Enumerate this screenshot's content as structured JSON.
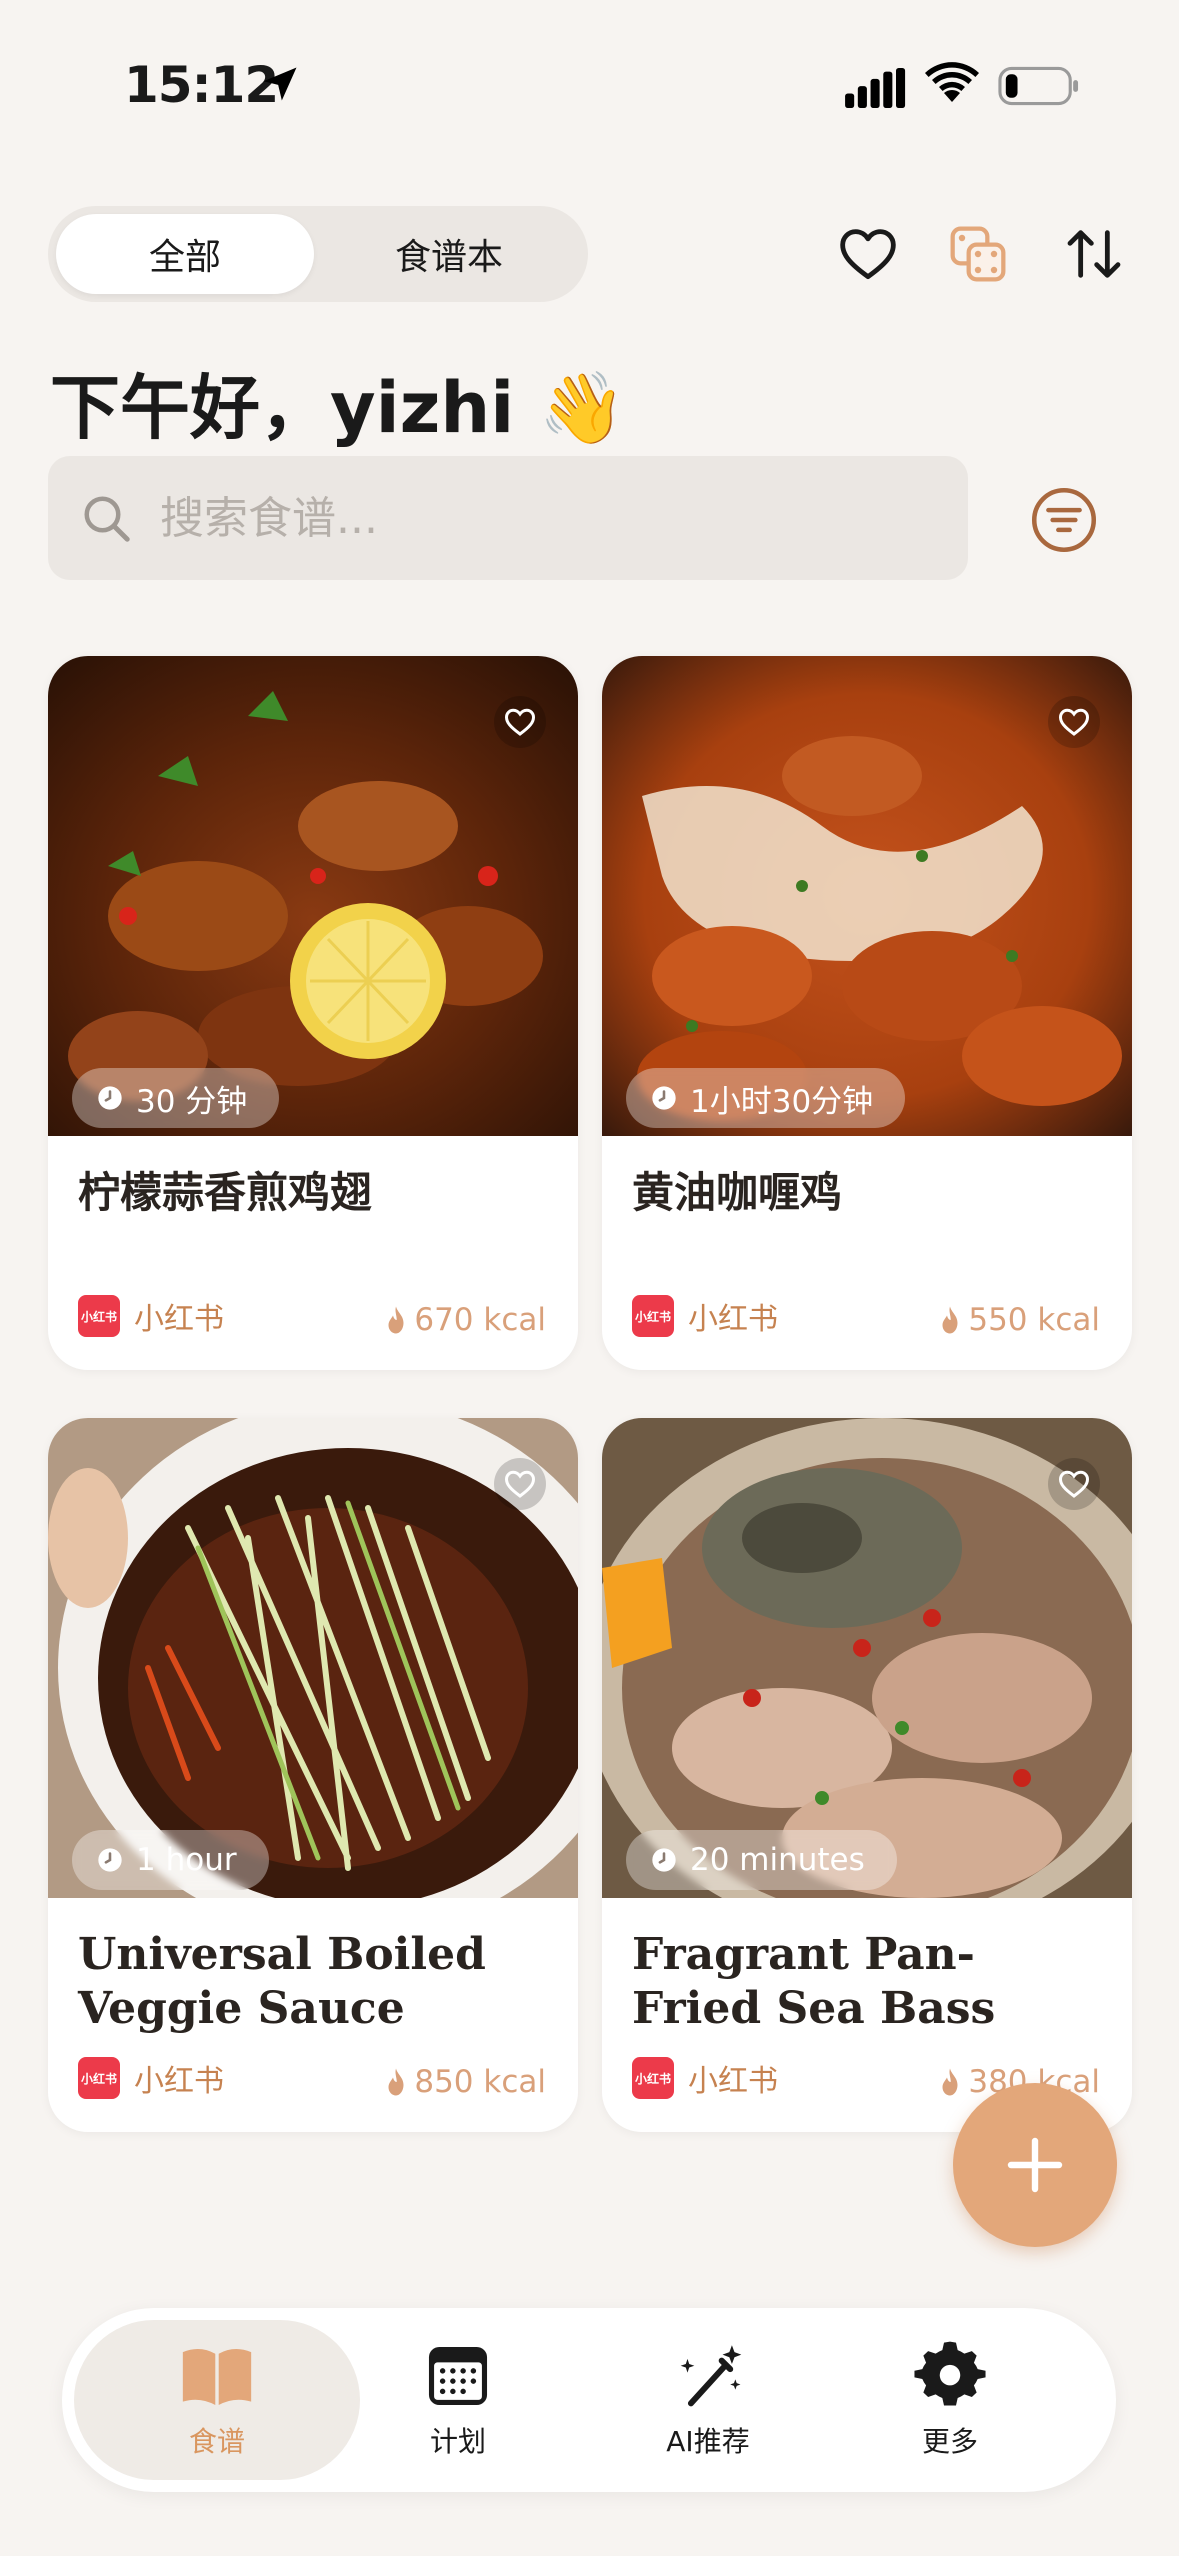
{
  "status_bar": {
    "time": "15:12"
  },
  "header": {
    "segments": [
      "全部",
      "食谱本"
    ],
    "active_segment": "全部"
  },
  "greeting": "下午好，yizhi 👋",
  "search": {
    "placeholder": "搜索食谱..."
  },
  "recipes": [
    {
      "title": "柠檬蒜香煎鸡翅",
      "time": "30 分钟",
      "source": "小红书",
      "kcal": "670 kcal"
    },
    {
      "title": "黄油咖喱鸡",
      "time": "1小时30分钟",
      "source": "小红书",
      "kcal": "550 kcal"
    },
    {
      "title": "Universal Boiled Veggie Sauce",
      "time": "1 hour",
      "source": "小红书",
      "kcal": "850 kcal"
    },
    {
      "title": "Fragrant Pan-Fried Sea Bass",
      "time": "20 minutes",
      "source": "小红书",
      "kcal": "380 kcal"
    }
  ],
  "tabbar": [
    {
      "label": "食谱",
      "icon": "book-icon"
    },
    {
      "label": "计划",
      "icon": "calendar-icon"
    },
    {
      "label": "AI推荐",
      "icon": "magic-wand-icon"
    },
    {
      "label": "更多",
      "icon": "gear-icon"
    }
  ],
  "colors": {
    "accent": "#e3a77a",
    "background": "#f7f4f1",
    "source_red": "#ec3a4a"
  }
}
